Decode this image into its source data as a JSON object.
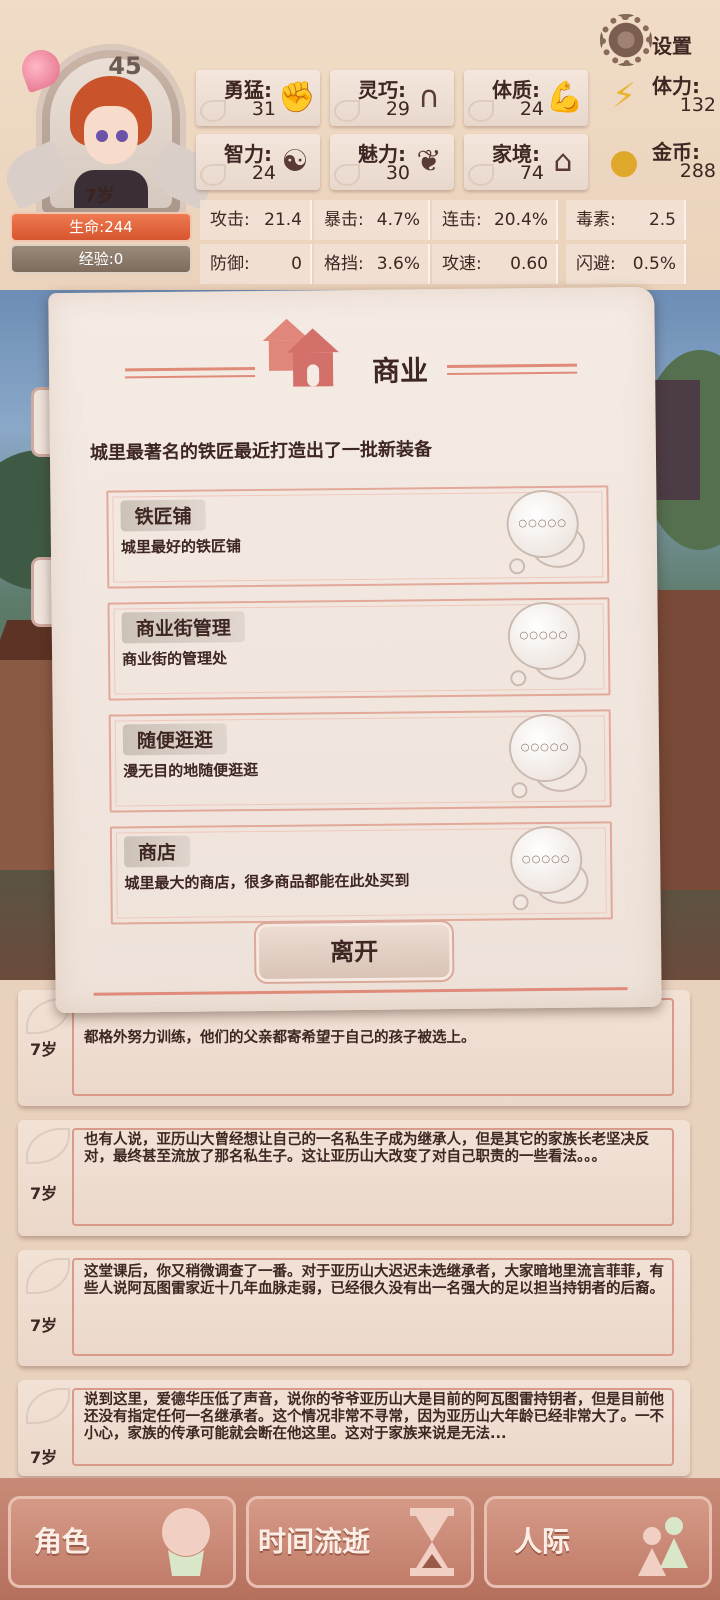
{
  "player": {
    "level": "45",
    "age_tag": "7岁",
    "hp_label": "生命:244",
    "exp_label": "经验:0"
  },
  "attributes": [
    {
      "label": "勇猛:",
      "value": "31",
      "icon": "fist-icon"
    },
    {
      "label": "灵巧:",
      "value": "29",
      "icon": "cloak-icon"
    },
    {
      "label": "体质:",
      "value": "24",
      "icon": "muscle-arm-icon"
    },
    {
      "label": "智力:",
      "value": "24",
      "icon": "brain-icon"
    },
    {
      "label": "魅力:",
      "value": "30",
      "icon": "flower-icon"
    },
    {
      "label": "家境:",
      "value": "74",
      "icon": "estate-icon"
    }
  ],
  "resources": [
    {
      "label": "体力:",
      "value": "132",
      "icon": "lightning-icon"
    },
    {
      "label": "金币:",
      "value": "288",
      "icon": "coin-icon"
    }
  ],
  "combat_stats": [
    {
      "label": "攻击:",
      "value": "21.4"
    },
    {
      "label": "暴击:",
      "value": "4.7%"
    },
    {
      "label": "连击:",
      "value": "20.4%"
    },
    {
      "label": "毒素:",
      "value": "2.5"
    },
    {
      "label": "防御:",
      "value": "0"
    },
    {
      "label": "格挡:",
      "value": "3.6%"
    },
    {
      "label": "攻速:",
      "value": "0.60"
    },
    {
      "label": "闪避:",
      "value": "0.5%"
    }
  ],
  "settings_label": "设置",
  "modal": {
    "title": "商业",
    "description": "城里最著名的铁匠最近打造出了一批新装备",
    "options": [
      {
        "name": "铁匠铺",
        "desc": "城里最好的铁匠铺",
        "bubble": "○○○○○"
      },
      {
        "name": "商业街管理",
        "desc": "商业街的管理处",
        "bubble": "○○○○○"
      },
      {
        "name": "随便逛逛",
        "desc": "漫无目的地随便逛逛",
        "bubble": "○○○○○"
      },
      {
        "name": "商店",
        "desc": "城里最大的商店，很多商品都能在此处买到",
        "bubble": "○○○○○"
      }
    ],
    "leave_label": "离开"
  },
  "log_entries": [
    {
      "age": "7岁",
      "text": "都格外努力训练，他们的父亲都寄希望于自己的孩子被选上。"
    },
    {
      "age": "7岁",
      "text": "也有人说，亚历山大曾经想让自己的一名私生子成为继承人，但是其它的家族长老坚决反对，最终甚至流放了那名私生子。这让亚历山大改变了对自己职责的一些看法。。。"
    },
    {
      "age": "7岁",
      "text": "这堂课后，你又稍微调查了一番。对于亚历山大迟迟未选继承者，大家暗地里流言菲菲，有些人说阿瓦图雷家近十几年血脉走弱，已经很久没有出一名强大的足以担当持钥者的后裔。"
    },
    {
      "age": "7岁",
      "text": "说到这里，爱德华压低了声音，说你的爷爷亚历山大是目前的阿瓦图雷持钥者，但是目前他还没有指定任何一名继承者。这个情况非常不寻常，因为亚历山大年龄已经非常大了。一不小心，家族的传承可能就会断在他这里。这对于家族来说是无法..."
    }
  ],
  "nav": [
    {
      "label": "角色",
      "icon": "character-icon"
    },
    {
      "label": "时间流逝",
      "icon": "hourglass-icon"
    },
    {
      "label": "人际",
      "icon": "people-icon"
    }
  ],
  "colors": {
    "accent": "#e08a7a",
    "hp": "#d6552e",
    "nav": "#c07b68",
    "paper": "#f4ebe4"
  }
}
